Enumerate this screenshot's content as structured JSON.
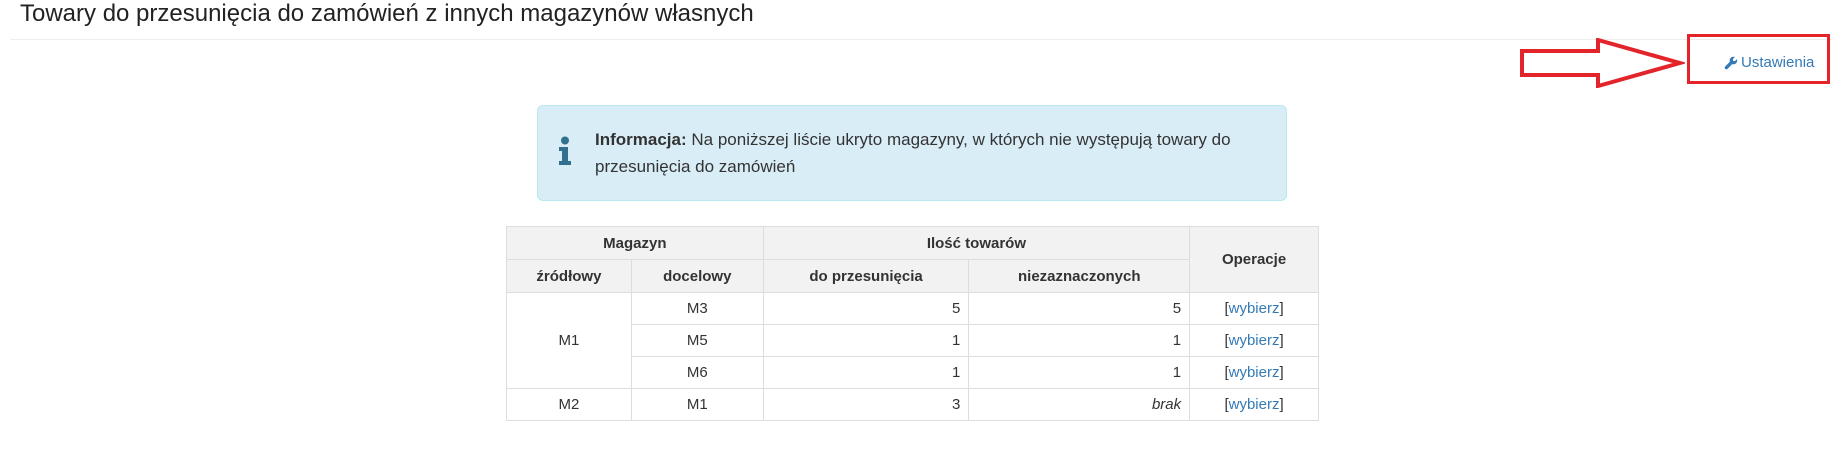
{
  "page": {
    "title": "Towary do przesunięcia do zamówień z innych magazynów własnych"
  },
  "toolbar": {
    "settings_label": "Ustawienia"
  },
  "info": {
    "label": "Informacja:",
    "message": "Na poniższej liście ukryto magazyny, w których nie występują towary do przesunięcia do zamówień"
  },
  "table": {
    "headers": {
      "magazyn": "Magazyn",
      "ilosc": "Ilość towarów",
      "operacje": "Operacje",
      "zrodlowy": "źródłowy",
      "docelowy": "docelowy",
      "do_przesuniecia": "do przesunięcia",
      "niezaznaczonych": "niezaznaczonych"
    },
    "groups": [
      {
        "source": "M1",
        "rows": [
          {
            "target": "M3",
            "to_move": "5",
            "unselected": "5",
            "action": "wybierz"
          },
          {
            "target": "M5",
            "to_move": "1",
            "unselected": "1",
            "action": "wybierz"
          },
          {
            "target": "M6",
            "to_move": "1",
            "unselected": "1",
            "action": "wybierz"
          }
        ]
      },
      {
        "source": "M2",
        "rows": [
          {
            "target": "M1",
            "to_move": "3",
            "unselected": "brak",
            "action": "wybierz"
          }
        ]
      }
    ]
  },
  "colors": {
    "link": "#337ab7",
    "info_bg": "#d9edf7",
    "info_icon": "#31708f",
    "annotation_red": "#e3242b"
  },
  "icons": {
    "settings": "wrench-icon",
    "info": "info-icon",
    "annotation": "arrow-right-icon"
  }
}
